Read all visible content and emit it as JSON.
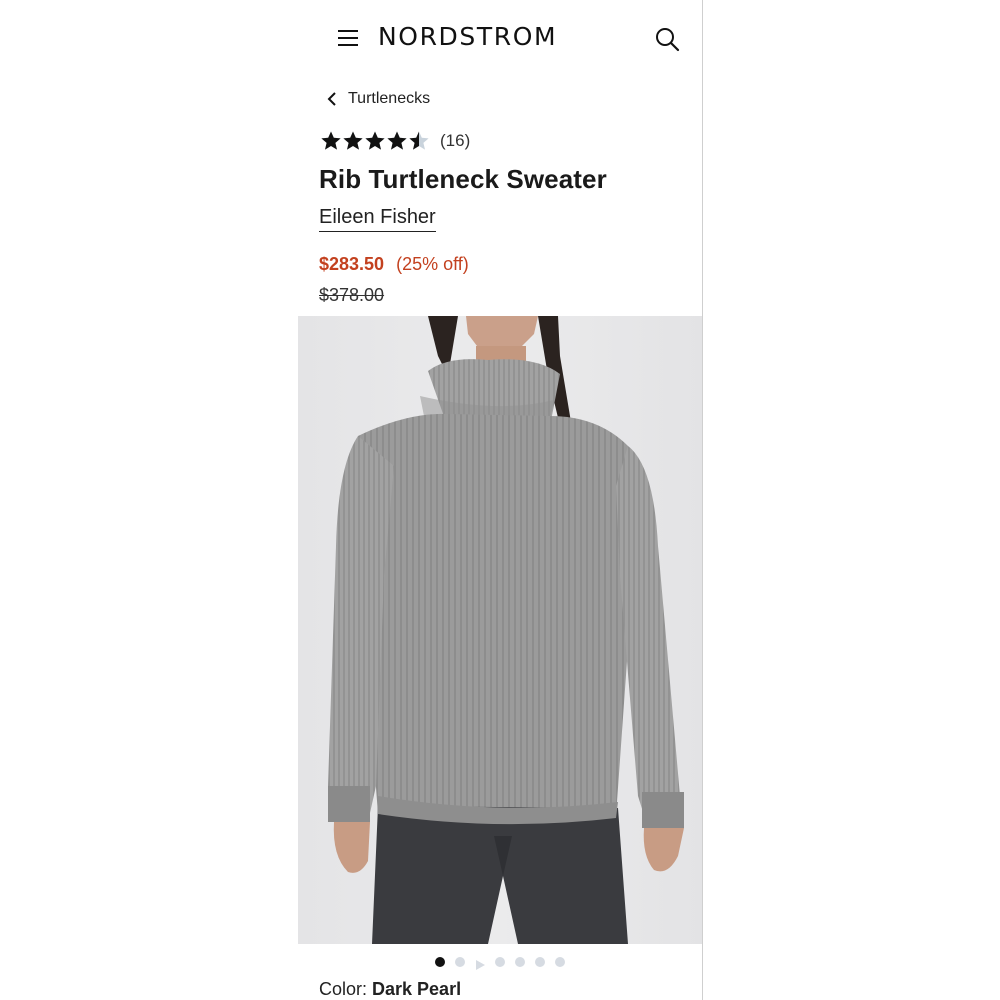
{
  "header": {
    "logo": "NORDSTROM",
    "menu_icon": "hamburger-menu-icon",
    "search_icon": "search-icon"
  },
  "breadcrumb": {
    "label": "Turtlenecks",
    "icon": "chevron-left-icon"
  },
  "product": {
    "rating": 4.5,
    "review_count": "(16)",
    "title": "Rib Turtleneck Sweater",
    "brand": "Eileen Fisher",
    "sale_price": "$283.50",
    "discount": "(25% off)",
    "original_price": "$378.00",
    "image_alt": "model wearing gray ribbed turtleneck sweater"
  },
  "carousel": {
    "count": 7,
    "active_index": 0,
    "video_index": 2
  },
  "color": {
    "label": "Color:",
    "value": "Dark Pearl"
  },
  "colors": {
    "sale": "#c3411f",
    "text": "#1a1a1a",
    "sweater": "#9a9a9a",
    "background": "#e6e6e6",
    "pants": "#3a3b3f"
  }
}
